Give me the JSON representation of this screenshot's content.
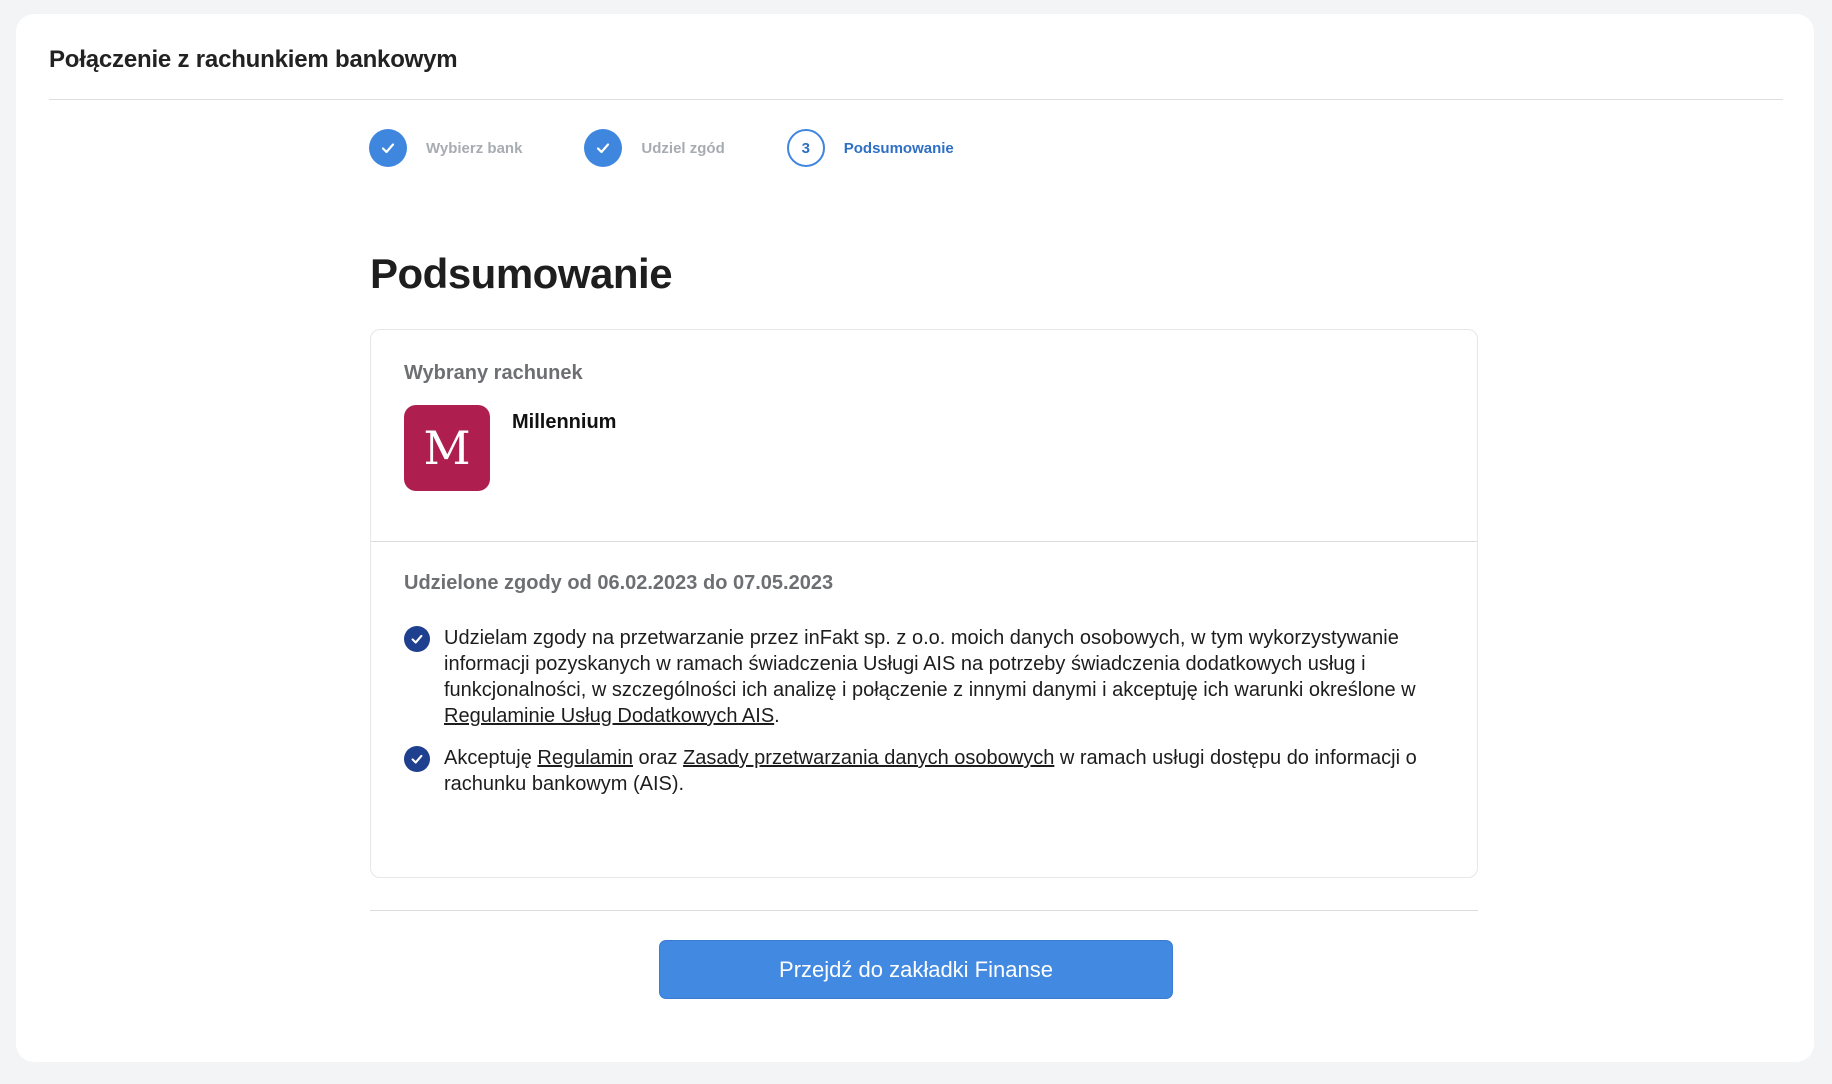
{
  "header": {
    "title": "Połączenie z rachunkiem bankowym"
  },
  "stepper": {
    "steps": [
      {
        "label": "Wybierz bank",
        "state": "done",
        "icon": "check-icon"
      },
      {
        "label": "Udziel zgód",
        "state": "done",
        "icon": "check-icon"
      },
      {
        "label": "Podsumowanie",
        "state": "current",
        "number": "3"
      }
    ]
  },
  "page": {
    "title": "Podsumowanie"
  },
  "account": {
    "section_title": "Wybrany rachunek",
    "bank_name": "Millennium",
    "bank_logo_letter": "M",
    "bank_logo_color": "#ae1f4f"
  },
  "consents": {
    "section_title": "Udzielone zgody od 06.02.2023 do 07.05.2023",
    "items": [
      {
        "text_before": "Udzielam zgody na przetwarzanie przez inFakt sp. z o.o. moich danych osobowych, w tym wykorzystywanie informacji pozyskanych w ramach świadczenia Usługi AIS na potrzeby świadczenia dodatkowych usług i funkcjonalności, w szczególności ich analizę i połączenie z innymi danymi i akceptuję ich warunki określone w ",
        "link": "Regulaminie Usług Dodatkowych AIS",
        "text_after": "."
      },
      {
        "text_before": "Akceptuję ",
        "link1": "Regulamin",
        "text_middle": " oraz ",
        "link2": "Zasady przetwarzania danych osobowych",
        "text_after": " w ramach usługi dostępu do informacji o rachunku bankowym (AIS)."
      }
    ]
  },
  "cta": {
    "label": "Przejdź do zakładki Finanse"
  },
  "colors": {
    "accent": "#428ae1",
    "check": "#1f3f8f",
    "current_step": "#2f6fc5"
  }
}
